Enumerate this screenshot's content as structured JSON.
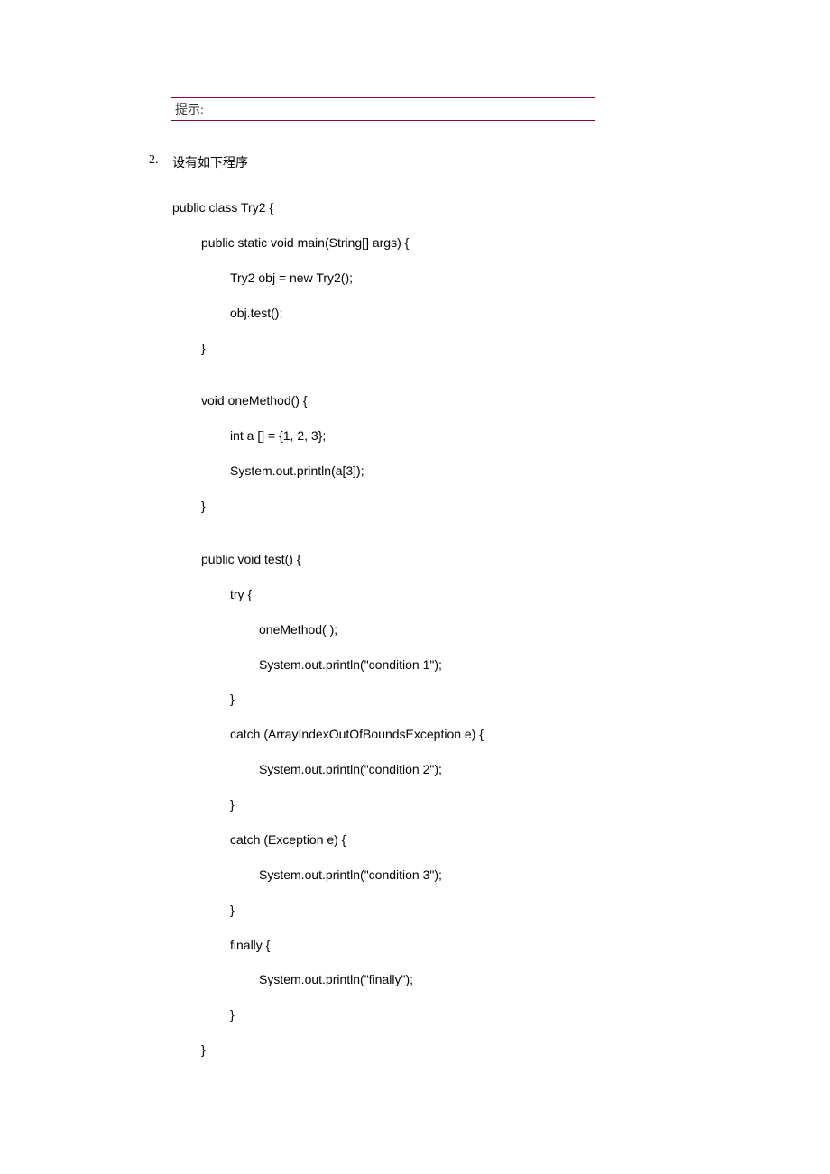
{
  "tip": {
    "label": "提示:"
  },
  "item": {
    "number": "2.",
    "text": "设有如下程序"
  },
  "code": {
    "lines": [
      {
        "indent": 0,
        "text": "public class Try2 {"
      },
      {
        "indent": 1,
        "text": "public static void main(String[] args) {"
      },
      {
        "indent": 2,
        "text": "Try2 obj = new Try2();"
      },
      {
        "indent": 2,
        "text": "obj.test();"
      },
      {
        "indent": 1,
        "text": "}"
      },
      {
        "indent": 0,
        "text": ""
      },
      {
        "indent": 1,
        "text": "void oneMethod() {"
      },
      {
        "indent": 2,
        "text": "int a [] = {1, 2, 3};"
      },
      {
        "indent": 2,
        "text": "System.out.println(a[3]);"
      },
      {
        "indent": 1,
        "text": "}"
      },
      {
        "indent": 0,
        "text": ""
      },
      {
        "indent": 1,
        "text": "public void test() {"
      },
      {
        "indent": 2,
        "text": "try {"
      },
      {
        "indent": 3,
        "text": "oneMethod( );"
      },
      {
        "indent": 3,
        "text": "System.out.println(\"condition 1\");"
      },
      {
        "indent": 2,
        "text": "}"
      },
      {
        "indent": 2,
        "text": "catch (ArrayIndexOutOfBoundsException e) {"
      },
      {
        "indent": 3,
        "text": "System.out.println(\"condition 2\");"
      },
      {
        "indent": 2,
        "text": "}"
      },
      {
        "indent": 2,
        "text": "catch (Exception e) {"
      },
      {
        "indent": 3,
        "text": "System.out.println(\"condition 3\");"
      },
      {
        "indent": 2,
        "text": "}"
      },
      {
        "indent": 2,
        "text": "finally {"
      },
      {
        "indent": 3,
        "text": "System.out.println(\"finally\");"
      },
      {
        "indent": 2,
        "text": "}"
      },
      {
        "indent": 1,
        "text": "}"
      }
    ]
  }
}
